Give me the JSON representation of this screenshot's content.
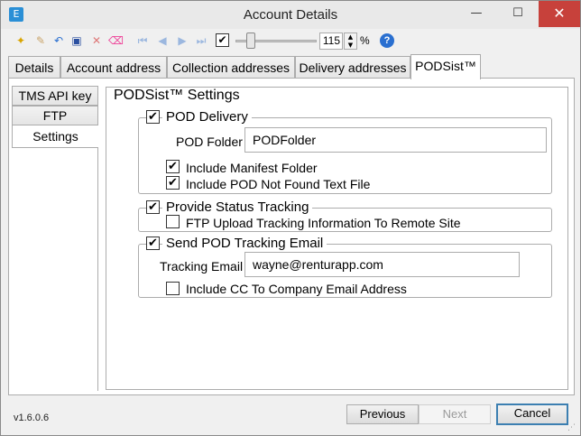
{
  "window": {
    "title": "Account Details",
    "minimize": "—",
    "maximize": "☐",
    "close": "✕"
  },
  "toolbar": {
    "zoom_value": "115",
    "zoom_unit": "%",
    "checkbox_checked": "✔",
    "spin_up": "▲",
    "spin_down": "▼",
    "help": "?"
  },
  "tabs": [
    {
      "label": "Details"
    },
    {
      "label": "Account address"
    },
    {
      "label": "Collection addresses"
    },
    {
      "label": "Delivery addresses"
    },
    {
      "label": "PODSist™"
    }
  ],
  "side_tabs": [
    {
      "label": "TMS API key"
    },
    {
      "label": "FTP"
    },
    {
      "label": "Settings"
    }
  ],
  "settings": {
    "title": "PODSist™ Settings",
    "pod_delivery": {
      "label": "POD Delivery",
      "checked": "✔",
      "folder_label": "POD Folder",
      "folder_value": "PODFolder",
      "include_manifest_label": "Include Manifest Folder",
      "include_manifest_checked": "✔",
      "include_not_found_label": "Include POD Not Found Text File",
      "include_not_found_checked": "✔"
    },
    "status_tracking": {
      "label": "Provide Status Tracking",
      "checked": "✔",
      "ftp_upload_label": "FTP Upload Tracking Information To Remote Site",
      "ftp_upload_checked": ""
    },
    "tracking_email": {
      "label": "Send POD Tracking Email",
      "checked": "✔",
      "email_label": "Tracking Email",
      "email_value": "wayne@renturapp.com",
      "include_cc_label": "Include CC To Company Email Address",
      "include_cc_checked": ""
    }
  },
  "footer": {
    "version": "v1.6.0.6",
    "previous": "Previous",
    "next": "Next",
    "cancel": "Cancel"
  }
}
